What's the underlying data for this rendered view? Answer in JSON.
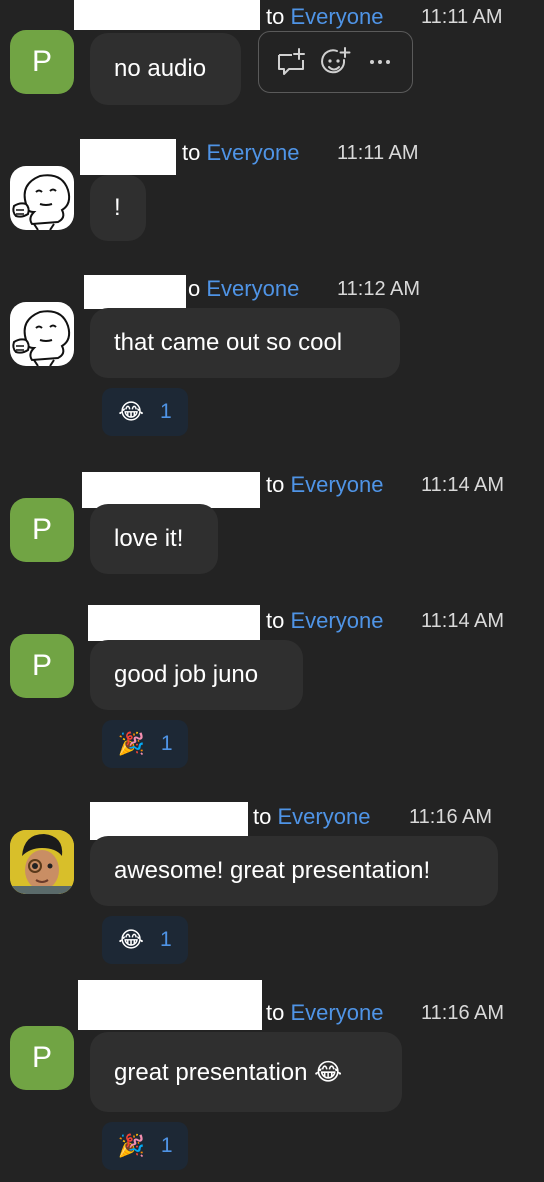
{
  "messages": [
    {
      "to_label": "to",
      "recipient": "Everyone",
      "time": "11:11 AM",
      "avatar_letter": "P",
      "text": "no audio"
    },
    {
      "to_label": "to",
      "recipient": "Everyone",
      "time": "11:11 AM",
      "text": "!"
    },
    {
      "to_label": "o",
      "recipient": "Everyone",
      "time": "11:12 AM",
      "text": "that came out so cool",
      "reaction": {
        "emoji": "😂",
        "count": "1"
      }
    },
    {
      "to_label": "to",
      "recipient": "Everyone",
      "time": "11:14 AM",
      "avatar_letter": "P",
      "text": "love it!"
    },
    {
      "to_label": "to",
      "recipient": "Everyone",
      "time": "11:14 AM",
      "avatar_letter": "P",
      "text": "good job juno",
      "reaction": {
        "emoji": "🎉",
        "count": "1"
      }
    },
    {
      "to_label": "to",
      "recipient": "Everyone",
      "time": "11:16 AM",
      "text": "awesome! great presentation!",
      "reaction": {
        "emoji": "😂",
        "count": "1"
      }
    },
    {
      "to_label": "to",
      "recipient": "Everyone",
      "time": "11:16 AM",
      "avatar_letter": "P",
      "text": "great presentation 😂",
      "reaction": {
        "emoji": "🎉",
        "count": "1"
      }
    }
  ],
  "toolbar_icons": [
    "reply-in-thread-icon",
    "add-reaction-icon",
    "more-options-icon"
  ],
  "colors": {
    "background": "#232323",
    "bubble": "#2f2f2f",
    "recipient": "#4f94e6",
    "avatar_green": "#71a444",
    "reaction_bg": "#1d2835"
  }
}
